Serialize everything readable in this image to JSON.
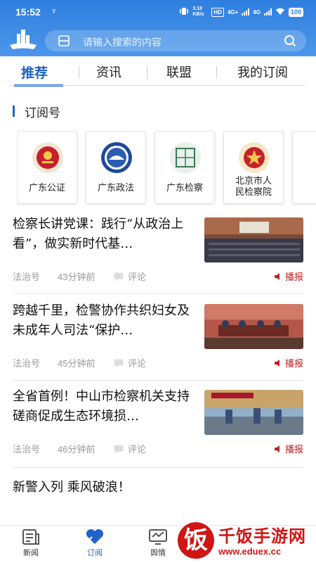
{
  "status_bar": {
    "time": "15:52",
    "extra": "♆",
    "speed": "3.10 KB/s",
    "hd": "HD",
    "net1": "4G+",
    "net2": "4G",
    "battery": "100"
  },
  "search": {
    "placeholder": "请输入搜索的内容"
  },
  "tabs": [
    {
      "label": "推荐",
      "active": true
    },
    {
      "label": "资讯",
      "active": false
    },
    {
      "label": "联盟",
      "active": false
    },
    {
      "label": "我的订阅",
      "active": false
    }
  ],
  "section": {
    "title": "订阅号"
  },
  "subscriptions": [
    {
      "name": "广东公证",
      "emblem_color": "#c8202a"
    },
    {
      "name": "广东政法",
      "emblem_color": "#1e4a9a"
    },
    {
      "name": "广东检察",
      "emblem_color": "#3c7a5a"
    },
    {
      "name_line1": "北京市人",
      "name_line2": "民检察院",
      "emblem_color": "#c8202a"
    }
  ],
  "news": [
    {
      "title": "检察长讲党课：践行“从政治上看”，做实新时代基…",
      "source": "法治号",
      "time": "43分钟前",
      "comment": "评论",
      "play": "播报"
    },
    {
      "title": "跨越千里，检警协作共织妇女及未成年人司法“保护…",
      "source": "法治号",
      "time": "45分钟前",
      "comment": "评论",
      "play": "播报"
    },
    {
      "title": "全省首例！中山市检察机关支持磋商促成生态环境损…",
      "source": "法治号",
      "time": "46分钟前",
      "comment": "评论",
      "play": "播报"
    }
  ],
  "lone_news": {
    "title": "新警入列 乘风破浪！"
  },
  "bottom_nav": [
    {
      "label": "新闻",
      "active": false
    },
    {
      "label": "订阅",
      "active": true
    },
    {
      "label": "舆情",
      "active": false
    }
  ],
  "watermark": {
    "glyph": "饭",
    "text": "千饭手游网",
    "url": "www.eduex.cc"
  }
}
